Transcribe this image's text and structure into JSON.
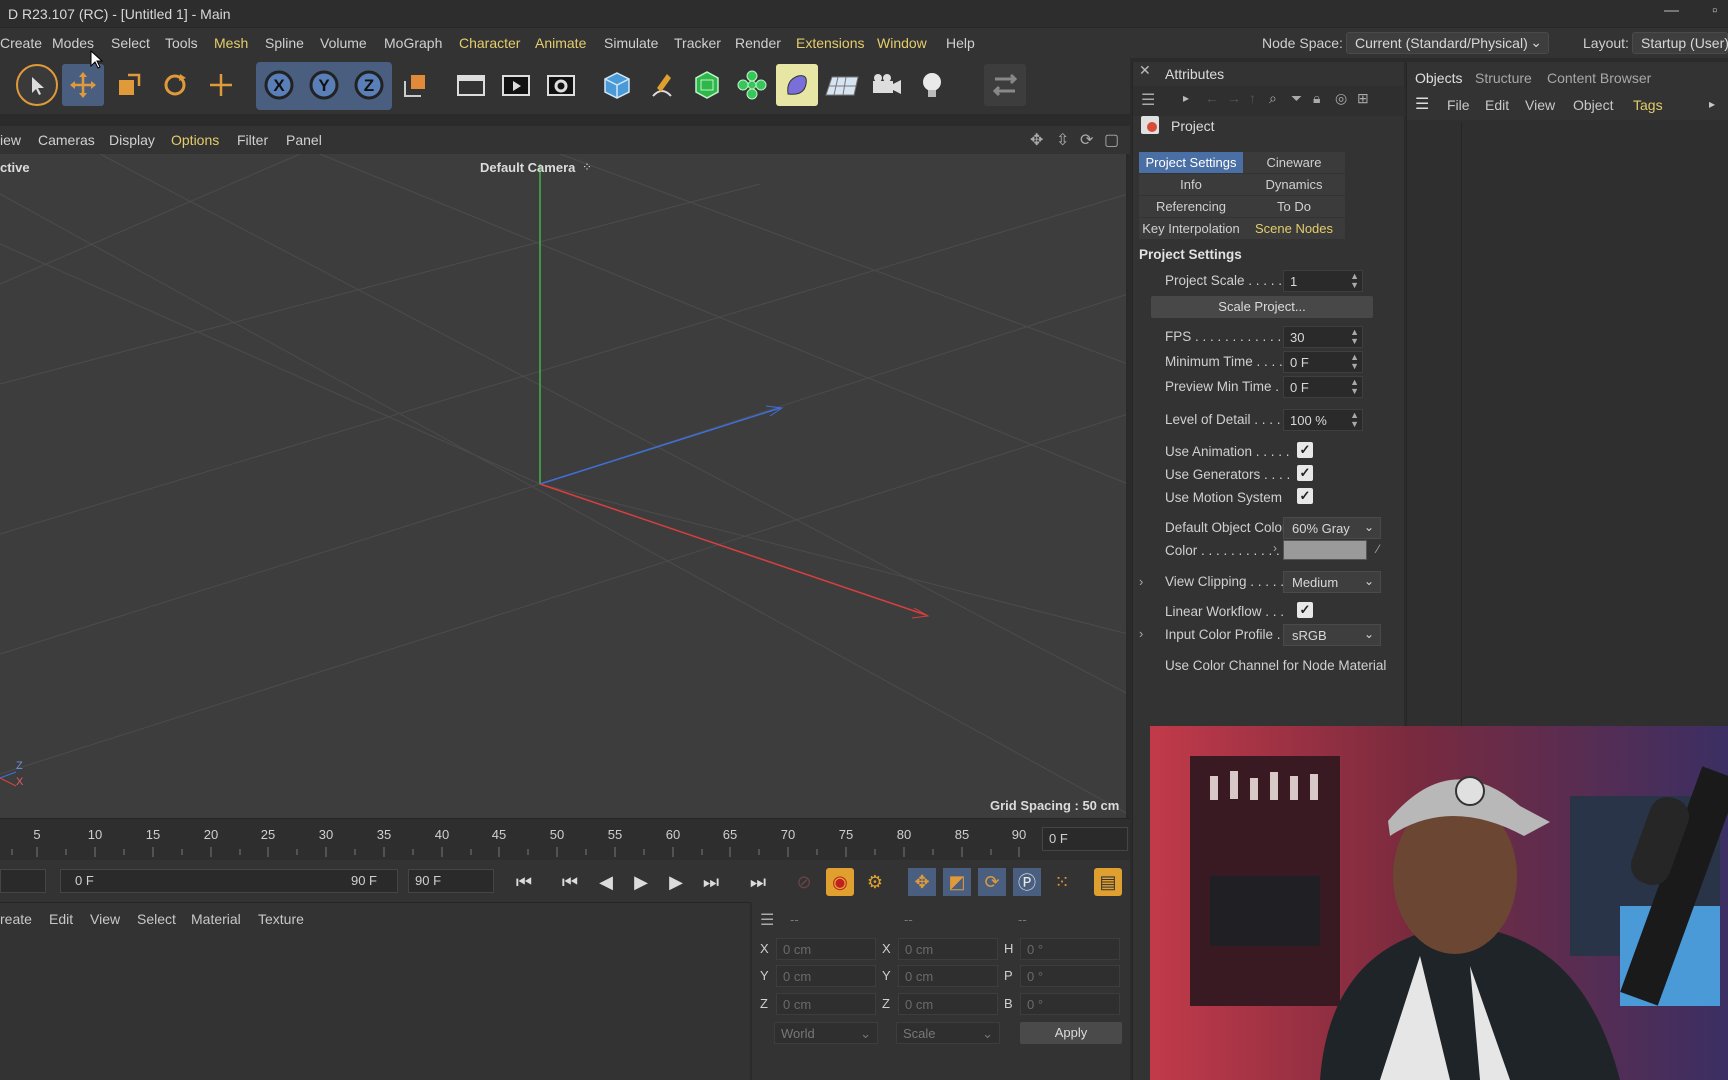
{
  "window": {
    "title": "D R23.107 (RC) - [Untitled 1] - Main"
  },
  "menubar": {
    "items": [
      "Create",
      "Modes",
      "Select",
      "Tools",
      "Mesh",
      "Spline",
      "Volume",
      "MoGraph",
      "Character",
      "Animate",
      "Simulate",
      "Tracker",
      "Render",
      "Extensions",
      "Window",
      "Help"
    ],
    "node_space_label": "Node Space:",
    "node_space_value": "Current (Standard/Physical)",
    "layout_label": "Layout:",
    "layout_value": "Startup (User)"
  },
  "toolbar": {
    "icons": [
      "select-icon",
      "move-icon",
      "scale-icon",
      "rotate-icon",
      "transform-icon",
      "x-axis-icon",
      "y-axis-icon",
      "z-axis-icon",
      "coordinate-system-icon",
      "render-view-icon",
      "render-picture-viewer-icon",
      "render-settings-icon",
      "cube-icon",
      "pen-icon",
      "subdivision-icon",
      "cloner-icon",
      "deformer-icon",
      "floor-icon",
      "camera-icon",
      "light-icon",
      "workplane-icon"
    ]
  },
  "viewport": {
    "menu": [
      "iew",
      "Cameras",
      "Display",
      "Options",
      "Filter",
      "Panel"
    ],
    "view_name": "ctive",
    "camera_label": "Default Camera",
    "grid_spacing": "Grid Spacing : 50 cm",
    "axis_labels": {
      "z": "Z",
      "x": "X"
    }
  },
  "timeline": {
    "ticks": [
      "5",
      "10",
      "15",
      "20",
      "25",
      "30",
      "35",
      "40",
      "45",
      "50",
      "55",
      "60",
      "65",
      "70",
      "75",
      "80",
      "85",
      "90"
    ],
    "current_frame": "0 F",
    "range_start": "0 F",
    "range_end": "90 F",
    "max_frame": "90 F"
  },
  "material_manager": {
    "menu": [
      "reate",
      "Edit",
      "View",
      "Select",
      "Material",
      "Texture"
    ]
  },
  "coordinates": {
    "header": [
      "--",
      "--",
      "--"
    ],
    "rows": [
      {
        "a": "X",
        "av": "0 cm",
        "b": "X",
        "bv": "0 cm",
        "c": "H",
        "cv": "0 °"
      },
      {
        "a": "Y",
        "av": "0 cm",
        "b": "Y",
        "bv": "0 cm",
        "c": "P",
        "cv": "0 °"
      },
      {
        "a": "Z",
        "av": "0 cm",
        "b": "Z",
        "bv": "0 cm",
        "c": "B",
        "cv": "0 °"
      }
    ],
    "mode": "World",
    "transform": "Scale",
    "apply_label": "Apply"
  },
  "attributes": {
    "title": "Attributes",
    "object_name": "Project",
    "tabs": [
      [
        "Project Settings",
        "Cineware"
      ],
      [
        "Info",
        "Dynamics"
      ],
      [
        "Referencing",
        "To Do"
      ],
      [
        "Key Interpolation",
        "Scene Nodes"
      ]
    ],
    "section": "Project Settings",
    "project_scale_label": "Project Scale . . . . . .",
    "project_scale_value": "1",
    "scale_button": "Scale Project...",
    "fps_label": "FPS . . . . . . . . . . . . .",
    "fps_value": "30",
    "min_time_label": "Minimum Time . . . .",
    "min_time_value": "0 F",
    "preview_min_label": "Preview Min Time . .",
    "preview_min_value": "0 F",
    "lod_label": "Level of Detail . . . . .",
    "lod_value": "100 %",
    "use_animation": "Use Animation . . . . .",
    "use_generators": "Use Generators . . . .",
    "use_motion": "Use Motion System",
    "default_color_label": "Default Object Color",
    "default_color_value": "60% Gray",
    "color_label": "Color . . . . . . . . . . .",
    "view_clipping_label": "View Clipping . . . . .",
    "view_clipping_value": "Medium",
    "linear_workflow": "Linear Workflow . . .",
    "input_profile_label": "Input Color Profile . .",
    "input_profile_value": "sRGB",
    "use_color_channel": "Use Color Channel for Node Material"
  },
  "objects_panel": {
    "tabs": [
      "Objects",
      "Structure",
      "Content Browser"
    ],
    "menu": [
      "File",
      "Edit",
      "View",
      "Object",
      "Tags"
    ]
  }
}
